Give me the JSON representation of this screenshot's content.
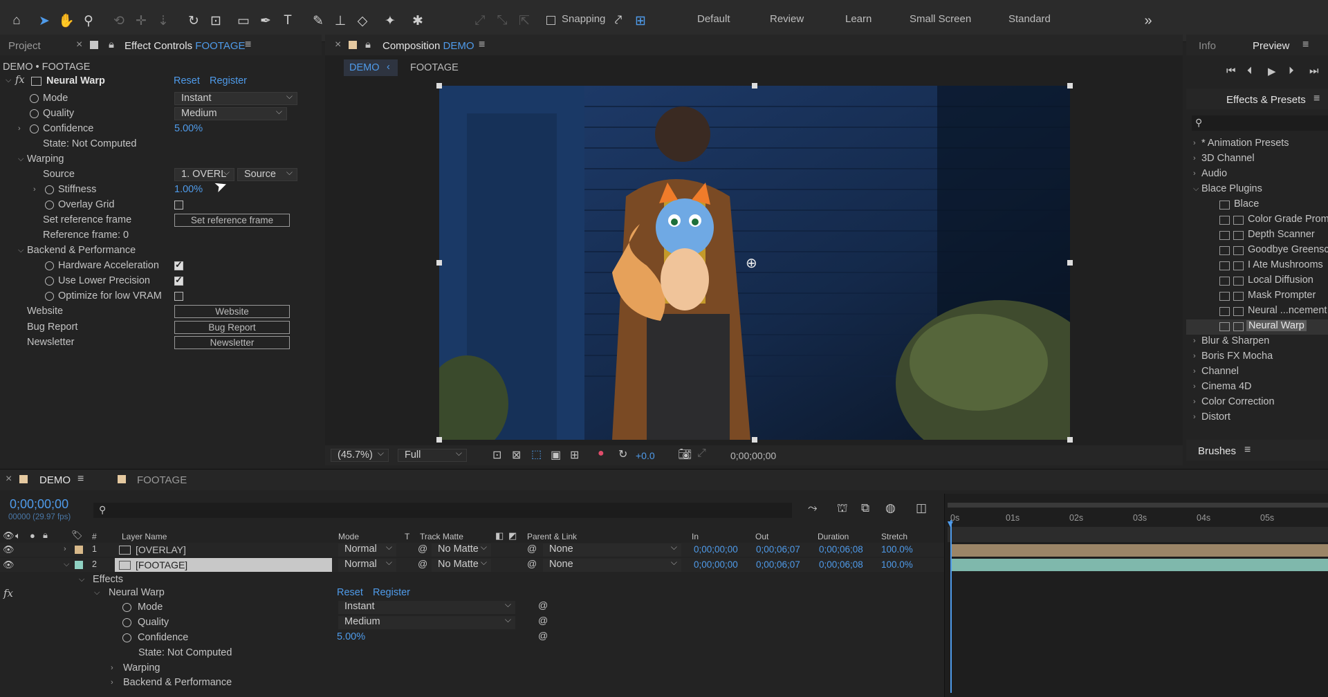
{
  "workspaces": [
    "Default",
    "Review",
    "Learn",
    "Small Screen",
    "Standard"
  ],
  "snapping_label": "Snapping",
  "left_panel": {
    "project_tab": "Project",
    "effect_controls_tab": "Effect Controls",
    "effect_controls_target": "FOOTAGE",
    "breadcrumb": "DEMO • FOOTAGE",
    "effect_name": "Neural Warp",
    "reset": "Reset",
    "register": "Register",
    "mode_label": "Mode",
    "mode_value": "Instant",
    "quality_label": "Quality",
    "quality_value": "Medium",
    "confidence_label": "Confidence",
    "confidence_value": "5.00%",
    "state": "State: Not Computed",
    "warping_label": "Warping",
    "source_label": "Source",
    "source_layer": "1. OVERL",
    "source_mode": "Source",
    "stiffness_label": "Stiffness",
    "stiffness_value": "1.00%",
    "overlay_grid_label": "Overlay Grid",
    "set_ref_label": "Set reference frame",
    "set_ref_button": "Set reference frame",
    "ref_frame": "Reference frame: 0",
    "backend_label": "Backend & Performance",
    "hw_accel_label": "Hardware Acceleration",
    "lower_precision_label": "Use Lower Precision",
    "low_vram_label": "Optimize for low VRAM",
    "website_label": "Website",
    "website_button": "Website",
    "bug_label": "Bug Report",
    "bug_button": "Bug Report",
    "newsletter_label": "Newsletter",
    "newsletter_button": "Newsletter"
  },
  "composition": {
    "tab_prefix": "Composition",
    "tab_name": "DEMO",
    "crumb_active": "DEMO",
    "crumb_next": "FOOTAGE",
    "zoom": "(45.7%)",
    "resolution": "Full",
    "exposure": "+0.0",
    "timecode": "0;00;00;00"
  },
  "right_panel": {
    "info_tab": "Info",
    "preview_tab": "Preview",
    "effects_tab": "Effects & Presets",
    "brushes_tab": "Brushes",
    "categories_top": [
      "* Animation Presets",
      "3D Channel",
      "Audio",
      "Blace Plugins"
    ],
    "blace_items": [
      "Blace",
      "Color Grade Prom",
      "Depth Scanner",
      "Goodbye Greensc",
      "I Ate Mushrooms",
      "Local Diffusion",
      "Mask Prompter",
      "Neural ...ncement",
      "Neural Warp"
    ],
    "categories_bottom": [
      "Blur & Sharpen",
      "Boris FX Mocha",
      "Channel",
      "Cinema 4D",
      "Color Correction",
      "Distort"
    ]
  },
  "timeline": {
    "tab_active": "DEMO",
    "tab_other": "FOOTAGE",
    "timecode": "0;00;00;00",
    "fps": "00000 (29.97 fps)",
    "col_num": "#",
    "col_layer": "Layer Name",
    "col_mode": "Mode",
    "col_t": "T",
    "col_matte": "Track Matte",
    "col_parent": "Parent & Link",
    "col_in": "In",
    "col_out": "Out",
    "col_duration": "Duration",
    "col_stretch": "Stretch",
    "ruler": [
      "0s",
      "01s",
      "02s",
      "03s",
      "04s",
      "05s"
    ],
    "layers": [
      {
        "num": "1",
        "name": "[OVERLAY]",
        "mode": "Normal",
        "matte": "No Matte",
        "parent": "None",
        "in": "0;00;00;00",
        "out": "0;00;06;07",
        "duration": "0;00;06;08",
        "stretch": "100.0%"
      },
      {
        "num": "2",
        "name": "[FOOTAGE]",
        "mode": "Normal",
        "matte": "No Matte",
        "parent": "None",
        "in": "0;00;00;00",
        "out": "0;00;06;07",
        "duration": "0;00;06;08",
        "stretch": "100.0%"
      }
    ],
    "effects_label": "Effects",
    "fx_label": "fx",
    "effect_name": "Neural Warp",
    "reset": "Reset",
    "register": "Register",
    "mode_label": "Mode",
    "mode_value": "Instant",
    "quality_label": "Quality",
    "quality_value": "Medium",
    "confidence_label": "Confidence",
    "confidence_value": "5.00%",
    "state": "State: Not Computed",
    "warping_label": "Warping",
    "backend_label": "Backend & Performance"
  },
  "colors": {
    "accent": "#4f9bea",
    "overlay_label": "#d8b98a",
    "footage_label": "#8fd1c2"
  }
}
